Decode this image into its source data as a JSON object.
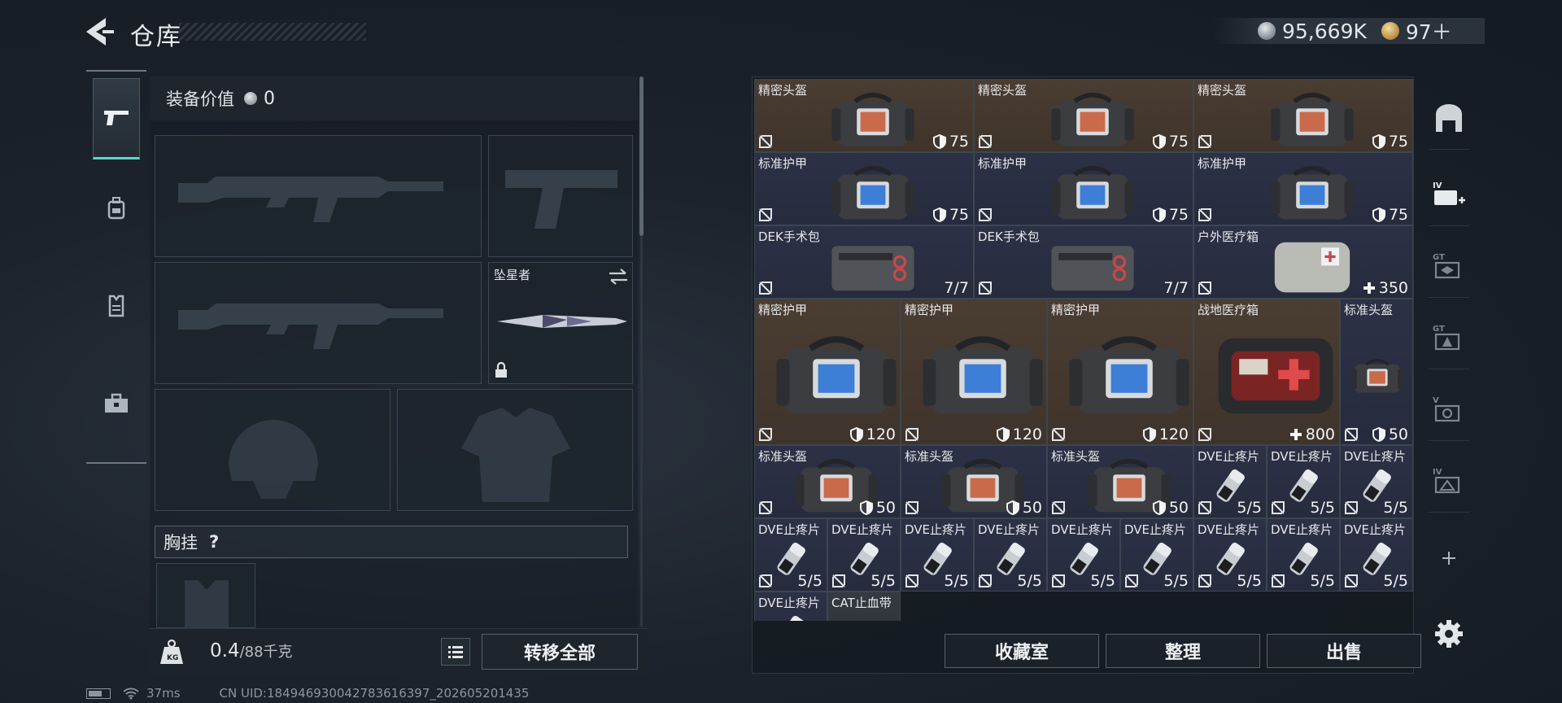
{
  "header": {
    "title": "仓库",
    "currency_silver": "95,669K",
    "currency_gold": "97＋"
  },
  "left_tabs": [
    {
      "icon": "pistol-icon",
      "active": true
    },
    {
      "icon": "backpack-icon",
      "active": false
    },
    {
      "icon": "vest-icon",
      "active": false
    },
    {
      "icon": "briefcase-icon",
      "active": false
    }
  ],
  "loadout": {
    "equipment_value_label": "装备价值",
    "equipment_value": "0",
    "melee_name": "坠星者",
    "chest_rig_label": "胸挂",
    "chest_rig_help": "?",
    "weight_value": "0.4",
    "weight_capacity": "/88千克",
    "transfer_all_label": "转移全部"
  },
  "inventory": {
    "items": [
      {
        "name": "精密头盔",
        "value": "75",
        "stat": "armor",
        "kind": "helmet-red",
        "bg": "brown"
      },
      {
        "name": "精密头盔",
        "value": "75",
        "stat": "armor",
        "kind": "helmet-red",
        "bg": "brown"
      },
      {
        "name": "精密头盔",
        "value": "75",
        "stat": "armor",
        "kind": "helmet-red",
        "bg": "brown"
      },
      {
        "name": "标准护甲",
        "value": "75",
        "stat": "armor",
        "kind": "vest-blue",
        "bg": "blue"
      },
      {
        "name": "标准护甲",
        "value": "75",
        "stat": "armor",
        "kind": "vest-blue",
        "bg": "blue"
      },
      {
        "name": "标准护甲",
        "value": "75",
        "stat": "armor",
        "kind": "vest-blue",
        "bg": "blue"
      },
      {
        "name": "DEK手术包",
        "value": "7/7",
        "stat": "none",
        "kind": "surgery-kit",
        "bg": "blue"
      },
      {
        "name": "DEK手术包",
        "value": "7/7",
        "stat": "none",
        "kind": "surgery-kit",
        "bg": "blue"
      },
      {
        "name": "户外医疗箱",
        "value": "350",
        "stat": "heal",
        "kind": "med-pouch",
        "bg": "blue"
      },
      {
        "name": "精密护甲",
        "value": "120",
        "stat": "armor",
        "kind": "vest-blue",
        "bg": "brown"
      },
      {
        "name": "精密护甲",
        "value": "120",
        "stat": "armor",
        "kind": "vest-blue",
        "bg": "brown"
      },
      {
        "name": "精密护甲",
        "value": "120",
        "stat": "armor",
        "kind": "vest-blue",
        "bg": "brown"
      },
      {
        "name": "战地医疗箱",
        "value": "800",
        "stat": "heal",
        "kind": "first-aid",
        "bg": "brown"
      },
      {
        "name": "标准头盔",
        "value": "50",
        "stat": "armor",
        "kind": "helmet-red-tall",
        "bg": "blue"
      },
      {
        "name": "标准头盔",
        "value": "50",
        "stat": "armor",
        "kind": "helmet-red",
        "bg": "blue"
      },
      {
        "name": "标准头盔",
        "value": "50",
        "stat": "armor",
        "kind": "helmet-red",
        "bg": "blue"
      },
      {
        "name": "标准头盔",
        "value": "50",
        "stat": "armor",
        "kind": "helmet-red",
        "bg": "blue"
      },
      {
        "name": "DVE止疼片",
        "value": "5/5",
        "stat": "none",
        "kind": "pill",
        "bg": "blue"
      },
      {
        "name": "DVE止疼片",
        "value": "5/5",
        "stat": "none",
        "kind": "pill",
        "bg": "blue"
      },
      {
        "name": "DVE止疼片",
        "value": "5/5",
        "stat": "none",
        "kind": "pill",
        "bg": "blue"
      },
      {
        "name": "DVE止疼片",
        "value": "5/5",
        "stat": "none",
        "kind": "pill",
        "bg": "blue"
      },
      {
        "name": "DVE止疼片",
        "value": "5/5",
        "stat": "none",
        "kind": "pill",
        "bg": "blue"
      },
      {
        "name": "DVE止疼片",
        "value": "5/5",
        "stat": "none",
        "kind": "pill",
        "bg": "blue"
      },
      {
        "name": "DVE止疼片",
        "value": "5/5",
        "stat": "none",
        "kind": "pill",
        "bg": "blue"
      },
      {
        "name": "DVE止疼片",
        "value": "5/5",
        "stat": "none",
        "kind": "pill",
        "bg": "blue"
      },
      {
        "name": "DVE止疼片",
        "value": "5/5",
        "stat": "none",
        "kind": "pill",
        "bg": "blue"
      },
      {
        "name": "DVE止疼片",
        "value": "5/5",
        "stat": "none",
        "kind": "pill",
        "bg": "blue"
      },
      {
        "name": "DVE止疼片",
        "value": "5/5",
        "stat": "none",
        "kind": "pill",
        "bg": "blue"
      },
      {
        "name": "DVE止疼片",
        "value": "5/5",
        "stat": "none",
        "kind": "pill",
        "bg": "blue"
      },
      {
        "name": "DVE止疼片",
        "value": "",
        "stat": "none",
        "kind": "pill",
        "bg": "blue"
      },
      {
        "name": "CAT止血带",
        "value": "",
        "stat": "none",
        "kind": "tourniquet",
        "bg": "gray"
      }
    ],
    "buttons": {
      "collection": "收藏室",
      "sort": "整理",
      "sell": "出售"
    }
  },
  "right_rail": [
    {
      "icon": "safe-box-icon",
      "label": ""
    },
    {
      "icon": "medkit-tier-icon",
      "label": "IV"
    },
    {
      "icon": "ammo-box-icon",
      "label": "GT"
    },
    {
      "icon": "armor-box-icon",
      "label": "GT"
    },
    {
      "icon": "vision-box-icon",
      "label": "V"
    },
    {
      "icon": "tier-box-icon",
      "label": "IV"
    },
    {
      "icon": "add-icon",
      "label": "+"
    }
  ],
  "status": {
    "ping": "37ms",
    "uid": "CN UID:18494693004278361639​7_202605201435"
  },
  "colors": {
    "accent_teal": "#5ed9c6",
    "rarity_brown": "#4a3d32",
    "rarity_blue": "#2c3146"
  }
}
